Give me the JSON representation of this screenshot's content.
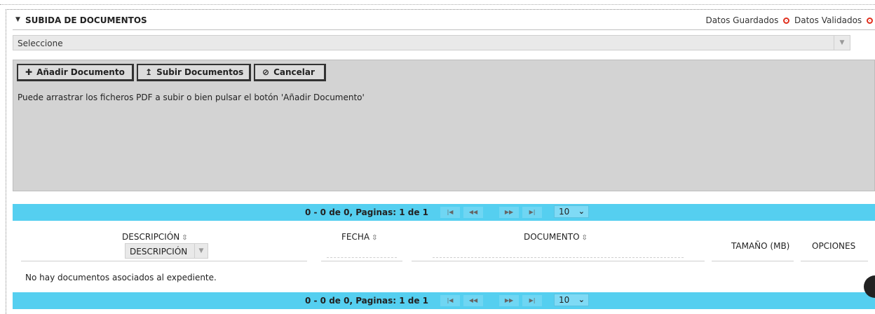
{
  "section": {
    "title": "SUBIDA DE DOCUMENTOS",
    "status_saved": "Datos Guardados",
    "status_validated": "Datos Validados"
  },
  "select": {
    "value": "Seleccione"
  },
  "upload": {
    "add_label": "Añadir Documento",
    "upload_label": "Subir Documentos",
    "cancel_label": "Cancelar",
    "hint": "Puede arrastrar los ficheros PDF a subir o bien pulsar el botón 'Añadir Documento'"
  },
  "pager": {
    "info": "0 - 0 de 0, Paginas: 1 de 1",
    "page_size": "10"
  },
  "table": {
    "columns": {
      "descripcion": "DESCRIPCIÓN",
      "fecha": "FECHA",
      "documento": "DOCUMENTO",
      "tamano": "TAMAÑO (MB)",
      "opciones": "OPCIONES"
    },
    "filter_value": "DESCRIPCIÓN",
    "empty_message": "No hay documentos asociados al expediente."
  },
  "colors": {
    "pager_bg": "#55cff0",
    "panel_bg": "#d3d3d3",
    "status_icon": "#e0301e"
  }
}
